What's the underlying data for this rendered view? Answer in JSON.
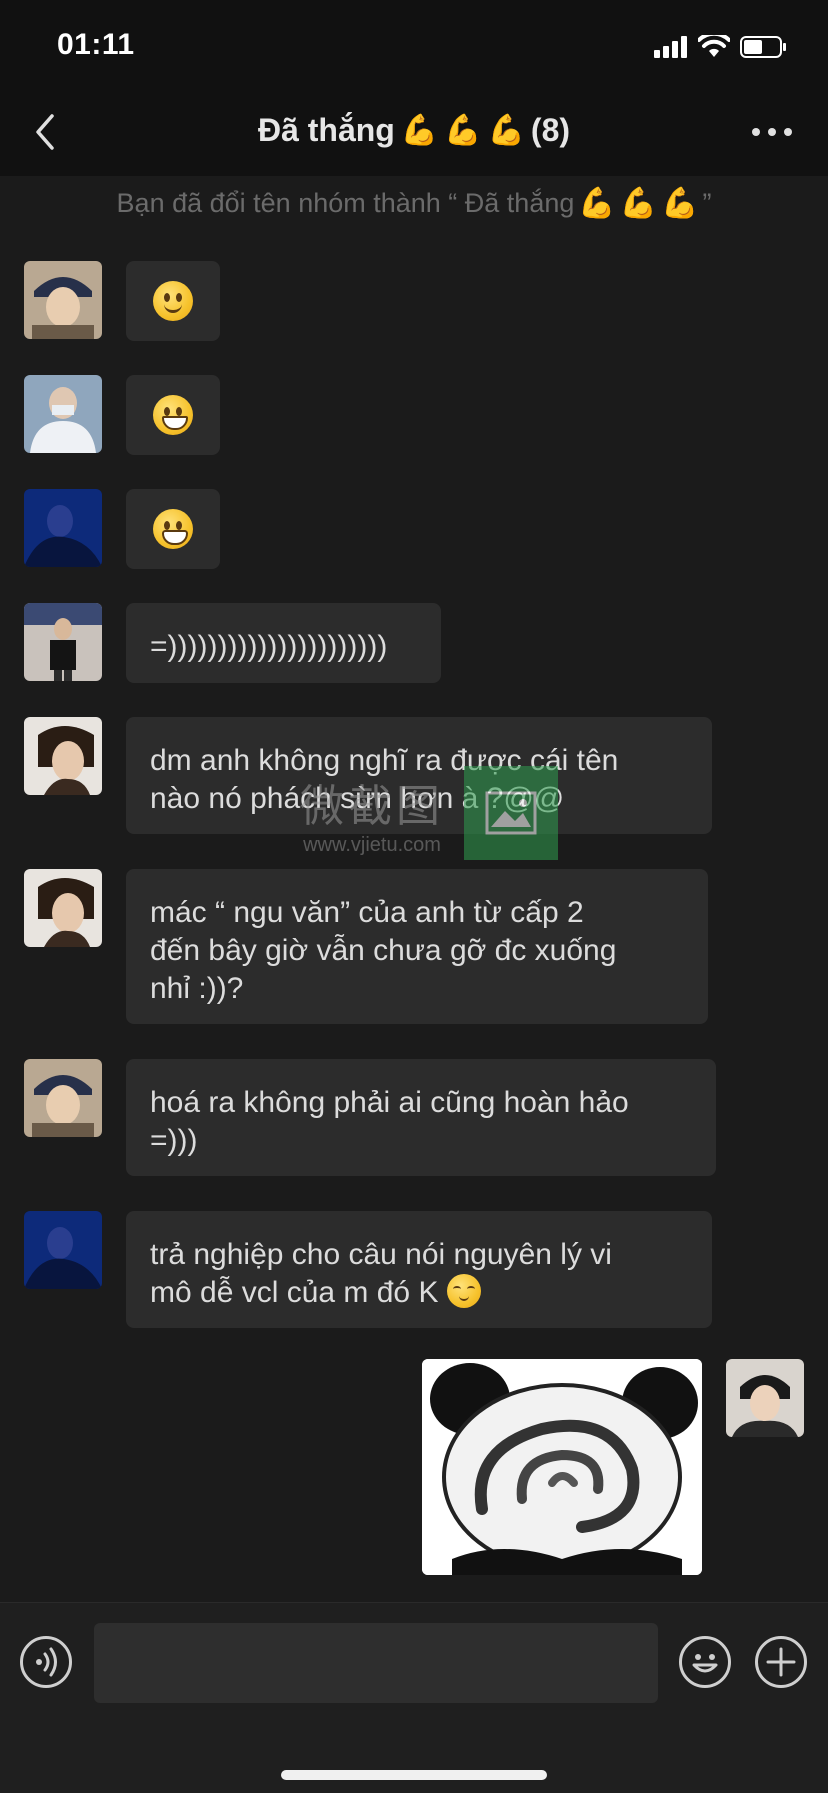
{
  "status_bar": {
    "time": "01:11"
  },
  "header": {
    "title": "Đã thắng",
    "title_emoji_count": 3,
    "member_count": "(8)"
  },
  "system_message": {
    "prefix": "Bạn đã đổi tên nhóm thành “ Đã thắng",
    "suffix": "”"
  },
  "messages": [
    {
      "type": "emoji",
      "emoji": "slightly-smiling-face"
    },
    {
      "type": "emoji",
      "emoji": "grinning-face"
    },
    {
      "type": "emoji",
      "emoji": "smiling-face-open-mouth"
    },
    {
      "type": "text",
      "lines": [
        "=))))))))))))))))))))))"
      ]
    },
    {
      "type": "text",
      "lines": [
        "dm anh không nghĩ ra được cái tên",
        "nào nó phách sừn hơn à ?@@"
      ]
    },
    {
      "type": "text",
      "lines": [
        "mác “ ngu văn” của anh từ cấp 2",
        "đến bây giờ vẫn chưa gỡ đc xuống",
        "nhỉ :))?"
      ]
    },
    {
      "type": "text",
      "lines": [
        "hoá ra không phải ai cũng hoàn hảo",
        "=)))"
      ]
    },
    {
      "type": "text",
      "lines": [
        "trả nghiệp cho câu nói nguyên lý vi",
        "mô dễ vcl của m đó K"
      ],
      "trailing_emoji": "relieved-face"
    },
    {
      "type": "sticker",
      "sender": "self",
      "sticker": "spinning-panda-face"
    }
  ],
  "watermark": {
    "cn": "微截图",
    "url": "www.vjietu.com"
  },
  "input_bar": {
    "value": ""
  },
  "colors": {
    "background": "#111111",
    "chat_bg": "#1b1b1b",
    "bubble": "#2c2c2c",
    "text": "#dcdcdc",
    "system_text": "#6b6b6b",
    "watermark_green": "#2f9e4f"
  }
}
